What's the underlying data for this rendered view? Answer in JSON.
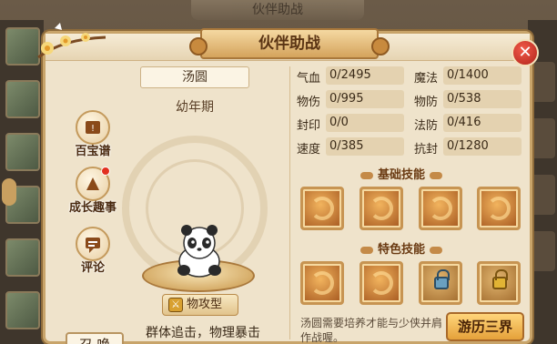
{
  "background": {
    "title": "伙伴助战"
  },
  "modal": {
    "title": "伙伴助战",
    "close_icon": "close-icon"
  },
  "partner": {
    "name": "汤圆",
    "stage": "幼年期",
    "type": "物攻型",
    "description": "群体追击，物理暴击"
  },
  "side_buttons": [
    {
      "label": "百宝谱",
      "icon": "treasure-book-icon",
      "has_alert": false
    },
    {
      "label": "成长趣事",
      "icon": "growth-story-icon",
      "has_alert": true
    },
    {
      "label": "评论",
      "icon": "comment-icon",
      "has_alert": false
    }
  ],
  "summon_label": "召 唤",
  "stats": [
    {
      "label": "气血",
      "value": "0/2495"
    },
    {
      "label": "魔法",
      "value": "0/1400"
    },
    {
      "label": "物伤",
      "value": "0/995"
    },
    {
      "label": "物防",
      "value": "0/538"
    },
    {
      "label": "封印",
      "value": "0/0"
    },
    {
      "label": "法防",
      "value": "0/416"
    },
    {
      "label": "速度",
      "value": "0/385"
    },
    {
      "label": "抗封",
      "value": "0/1280"
    }
  ],
  "basic_skills_title": "基础技能",
  "special_skills_title": "特色技能",
  "note": "汤圆需要培养才能与少侠并肩作战喔。",
  "journey_label": "游历三界",
  "colors": {
    "panel_bg": "#efe3cb",
    "accent_gold": "#c8a46a",
    "close_red": "#c93024"
  }
}
